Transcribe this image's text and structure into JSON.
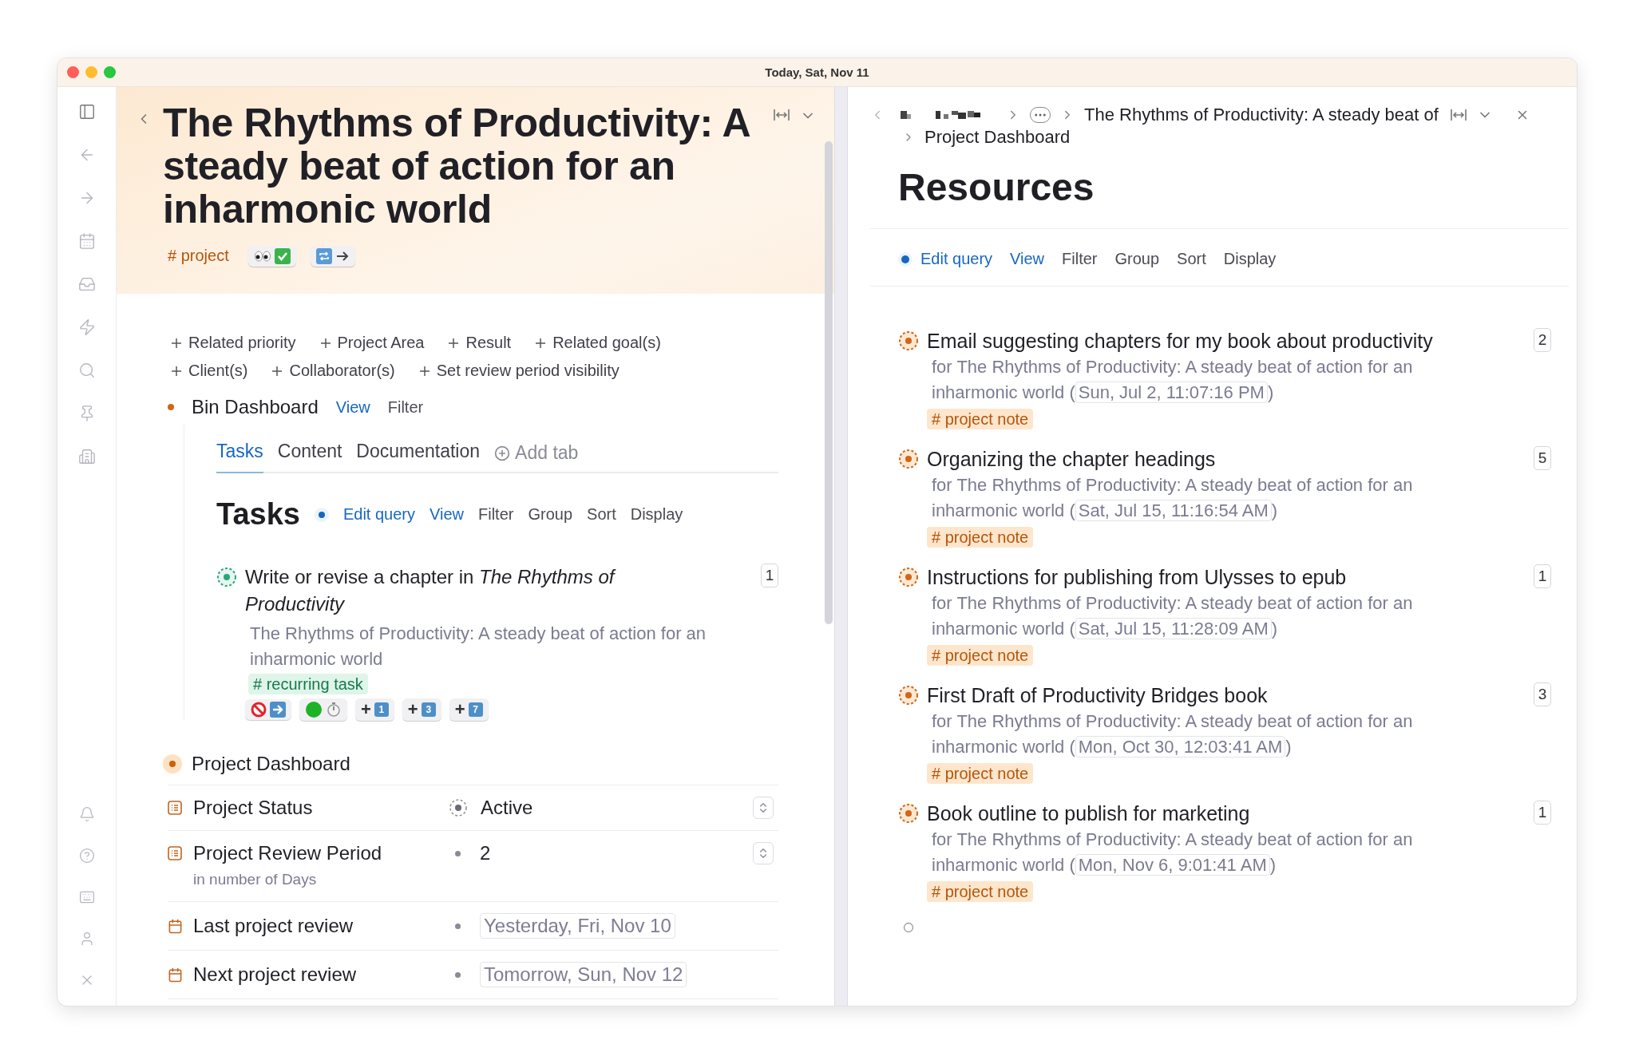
{
  "window": {
    "title": "Today, Sat, Nov 11"
  },
  "left": {
    "title": "The Rhythms of Productivity: A steady beat of action for an inharmonic world",
    "tag": "# project",
    "property_links": [
      "Related priority",
      "Project Area",
      "Result",
      "Related goal(s)",
      "Client(s)",
      "Collaborator(s)",
      "Set review period visibility"
    ],
    "bin": {
      "label": "Bin Dashboard",
      "actions": [
        {
          "label": "View",
          "kind": "link"
        },
        {
          "label": "Filter",
          "kind": "plain"
        }
      ]
    },
    "tabs": [
      {
        "label": "Tasks",
        "selected": true
      },
      {
        "label": "Content",
        "selected": false
      },
      {
        "label": "Documentation",
        "selected": false
      }
    ],
    "add_tab": "Add tab",
    "query": {
      "heading": "Tasks",
      "active": true,
      "actions": [
        {
          "label": "Edit query",
          "kind": "link"
        },
        {
          "label": "View",
          "kind": "link"
        },
        {
          "label": "Filter",
          "kind": "plain"
        },
        {
          "label": "Group",
          "kind": "plain"
        },
        {
          "label": "Sort",
          "kind": "plain"
        },
        {
          "label": "Display",
          "kind": "plain"
        }
      ]
    },
    "task": {
      "title": "Write or revise a chapter in *The Rhythms of Productivity*",
      "parent": "The Rhythms of Productivity: A steady beat of action for an inharmonic world",
      "tag": "# recurring task",
      "count": "1",
      "shortcuts": [
        {
          "label": "+",
          "key": "1"
        },
        {
          "label": "+",
          "key": "3"
        },
        {
          "label": "+",
          "key": "7"
        }
      ]
    },
    "dashboard": {
      "label": "Project Dashboard",
      "fields": [
        {
          "kind": "select",
          "label": "Project Status",
          "value": "Active"
        },
        {
          "kind": "number",
          "label": "Project Review Period",
          "value": "2",
          "note": "in number of Days"
        },
        {
          "kind": "date",
          "label": "Last project review",
          "value": "Yesterday, Fri, Nov 10"
        },
        {
          "kind": "date",
          "label": "Next project review",
          "value": "Tomorrow, Sun, Nov 12"
        }
      ]
    }
  },
  "right": {
    "breadcrumb": {
      "current": "The Rhythms of Productivity: A steady beat of",
      "child": "Project Dashboard"
    },
    "heading": "Resources",
    "query": {
      "active": true,
      "actions": [
        {
          "label": "Edit query",
          "kind": "link"
        },
        {
          "label": "View",
          "kind": "link"
        },
        {
          "label": "Filter",
          "kind": "plain"
        },
        {
          "label": "Group",
          "kind": "plain"
        },
        {
          "label": "Sort",
          "kind": "plain"
        },
        {
          "label": "Display",
          "kind": "plain"
        }
      ]
    },
    "items": [
      {
        "title": "Email suggesting chapters for my book about productivity",
        "parent": "for The Rhythms of Productivity: A steady beat of action for an inharmonic world (",
        "date": "Sun, Jul 2, 11:07:16 PM",
        "closing": ")",
        "tag": "# project note",
        "count": "2"
      },
      {
        "title": "Organizing the chapter headings",
        "parent": "for The Rhythms of Productivity: A steady beat of action for an inharmonic world (",
        "date": "Sat, Jul 15, 11:16:54 AM",
        "closing": ")",
        "tag": "# project note",
        "count": "5"
      },
      {
        "title": "Instructions for publishing from Ulysses to epub",
        "parent": "for The Rhythms of Productivity: A steady beat of action for an inharmonic world (",
        "date": "Sat, Jul 15, 11:28:09 AM",
        "closing": ")",
        "tag": "# project note",
        "count": "1"
      },
      {
        "title": "First Draft of Productivity Bridges book",
        "parent": "for The Rhythms of Productivity: A steady beat of action for an inharmonic world (",
        "date": "Mon, Oct 30, 12:03:41 AM",
        "closing": ")",
        "tag": "# project note",
        "count": "3"
      },
      {
        "title": "Book outline to publish for marketing",
        "parent": "for The Rhythms of Productivity: A steady beat of action for an inharmonic world (",
        "date": "Mon, Nov 6, 9:01:41 AM",
        "closing": ")",
        "tag": "# project note",
        "count": "1"
      }
    ]
  }
}
